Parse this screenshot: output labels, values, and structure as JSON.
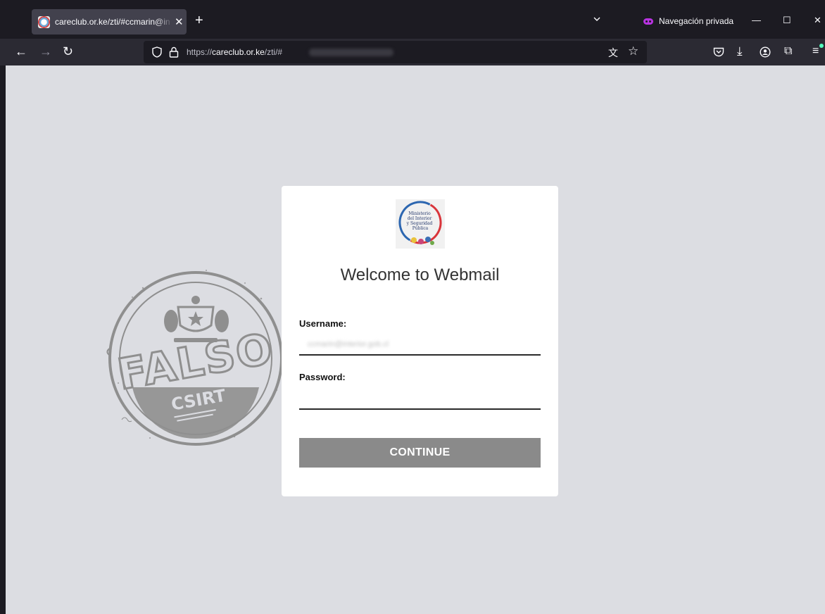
{
  "browser": {
    "tab": {
      "title": "careclub.or.ke/zti/#ccmarin@in"
    },
    "private_label": "Navegación privada",
    "url": {
      "prefix": "https://",
      "domain": "careclub.or.ke",
      "path": "/zti/#"
    }
  },
  "page": {
    "logo": {
      "lines": [
        "Ministerio",
        "del Interior",
        "y Seguridad",
        "Pública"
      ]
    },
    "heading": "Welcome to Webmail",
    "username": {
      "label": "Username:",
      "value": "ccmarin@interior.gob.cl"
    },
    "password": {
      "label": "Password:",
      "value": ""
    },
    "continue_label": "CONTINUE"
  },
  "stamp": {
    "word": "FALSO",
    "band": "CSIRT"
  },
  "colors": {
    "page_bg": "#dcdde2",
    "button": "#8a8a8a",
    "private_accent": "#b833e1",
    "stamp": "#8f8f8f"
  }
}
